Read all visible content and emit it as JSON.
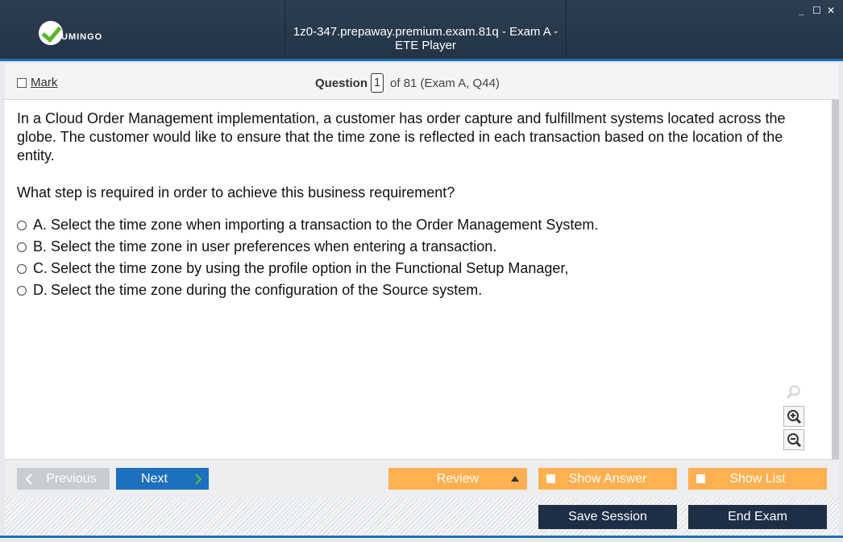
{
  "window": {
    "title": "1z0-347.prepaway.premium.exam.81q - Exam A - ETE Player",
    "logo_text": "UMINGO",
    "controls": [
      "_",
      "☐",
      "✕"
    ]
  },
  "header": {
    "mark_label": "Mark",
    "question_label": "Question",
    "question_number": "1",
    "question_total": "of 81 (Exam A, Q44)"
  },
  "question": {
    "text": "In a Cloud Order Management implementation, a customer has order capture and fulfillment systems located across the globe. The customer would like to ensure that the time zone is reflected in each transaction based on the location of the entity.",
    "prompt": "What step is required in order to achieve this business requirement?",
    "options": [
      {
        "letter": "A.",
        "text": "Select the time zone when importing a transaction to the Order Management System."
      },
      {
        "letter": "B.",
        "text": "Select the time zone in user preferences when entering a transaction."
      },
      {
        "letter": "C.",
        "text": "Select the time zone by using the profile option in the Functional Setup Manager,"
      },
      {
        "letter": "D.",
        "text": "Select the time zone during the configuration of the Source system."
      }
    ]
  },
  "nav": {
    "previous_label": "Previous",
    "next_label": "Next",
    "review_label": "Review",
    "show_answer_label": "Show Answer",
    "show_list_label": "Show List"
  },
  "footer": {
    "save_label": "Save Session",
    "end_label": "End Exam"
  },
  "colors": {
    "titlebar": "#243447",
    "accent": "#1f6fb2",
    "next_button": "#1d6fbf",
    "orange_buttons": "#ffb050",
    "footer_buttons": "#1d2e45"
  }
}
